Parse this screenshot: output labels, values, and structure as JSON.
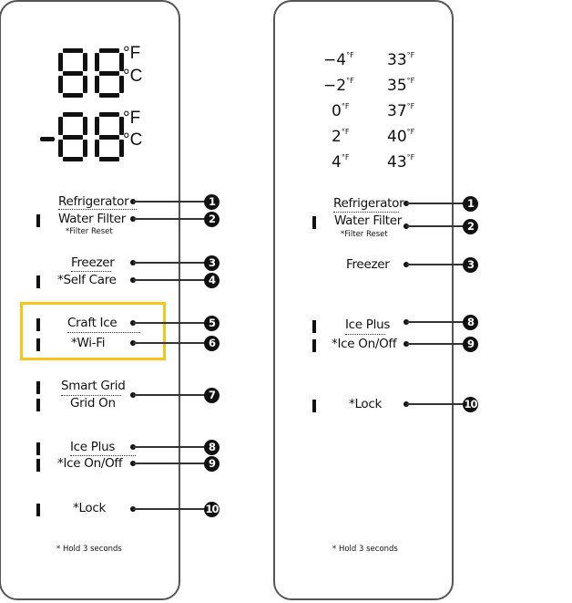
{
  "left_panel": {
    "display": {
      "fridge_units": [
        "°F",
        "°C"
      ],
      "freezer_units": [
        "°F",
        "°C"
      ],
      "freezer_minus": "-"
    },
    "controls": [
      {
        "label": "Refrigerator",
        "number": "1",
        "indicator": false
      },
      {
        "label": "Water Filter",
        "number": "2",
        "indicator": true,
        "sublabel": "*Filter Reset"
      },
      {
        "label": "Freezer",
        "number": "3",
        "indicator": false
      },
      {
        "label": "*Self Care",
        "number": "4",
        "indicator": true
      },
      {
        "label": "Craft Ice",
        "number": "5",
        "indicator": true,
        "highlighted": true
      },
      {
        "label": "*Wi-Fi",
        "number": "6",
        "indicator": true,
        "highlighted": true
      },
      {
        "label": "Smart Grid",
        "number": "7",
        "indicator": true
      },
      {
        "label": "Grid On",
        "number": "7",
        "indicator": true
      },
      {
        "label": "Ice Plus",
        "number": "8",
        "indicator": true
      },
      {
        "label": "*Ice On/Off",
        "number": "9",
        "indicator": true
      },
      {
        "label": "*Lock",
        "number": "10",
        "indicator": true
      }
    ],
    "footnote": "* Hold 3 seconds",
    "highlight_color": "#f5c518"
  },
  "right_panel": {
    "freezer_temps": [
      "-4",
      "-2",
      "0",
      "2",
      "4"
    ],
    "fridge_temps": [
      "33",
      "35",
      "37",
      "40",
      "43"
    ],
    "temp_unit": "°F",
    "controls": [
      {
        "label": "Refrigerator",
        "number": "1",
        "indicator": false
      },
      {
        "label": "Water Filter",
        "number": "2",
        "indicator": true,
        "sublabel": "*Filter Reset"
      },
      {
        "label": "Freezer",
        "number": "3",
        "indicator": false
      },
      {
        "label": "Ice Plus",
        "number": "8",
        "indicator": true
      },
      {
        "label": "*Ice On/Off",
        "number": "9",
        "indicator": true
      },
      {
        "label": "*Lock",
        "number": "10",
        "indicator": true
      }
    ],
    "footnote": "* Hold 3 seconds"
  }
}
